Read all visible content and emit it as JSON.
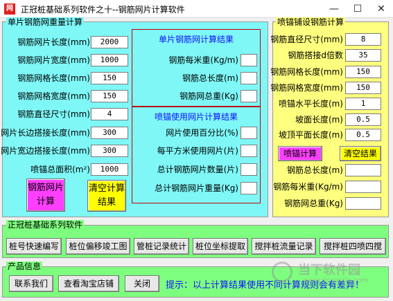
{
  "window": {
    "icon_text": "网",
    "title": "正冠桩基础系列软件之十--钢筋网片计算软件",
    "min": "—",
    "max": "☐",
    "close": "✕"
  },
  "left": {
    "legend": "单片钢筋网重量计算",
    "fields": [
      {
        "label": "钢筋网片长度(mm)",
        "value": "2000"
      },
      {
        "label": "钢筋网片宽度(mm)",
        "value": "1000"
      },
      {
        "label": "钢筋网格长度(mm)",
        "value": "150"
      },
      {
        "label": "钢筋网格宽度(mm)",
        "value": "150"
      },
      {
        "label": "钢筋直径尺寸(mm)",
        "value": "4"
      },
      {
        "label": "网片长边搭接长度(mm)",
        "value": "300"
      },
      {
        "label": "网片宽边搭接长度(mm)",
        "value": "300"
      },
      {
        "label": "喷锚总面积(m²)",
        "value": "1000"
      }
    ],
    "calc_btn": "钢筋网片计算",
    "clear_btn": "清空计算结果"
  },
  "results1": {
    "title": "单片钢筋网计算结果",
    "fields": [
      {
        "label": "钢筋每米重(Kg/m)",
        "value": ""
      },
      {
        "label": "钢筋总长度(m)",
        "value": ""
      },
      {
        "label": "钢筋网总重(Kg)",
        "value": ""
      }
    ]
  },
  "results2": {
    "title": "喷锚使用网片计算结果",
    "fields": [
      {
        "label": "网片使用百分比(%)",
        "value": ""
      },
      {
        "label": "每平方米使用网片(片)",
        "value": ""
      },
      {
        "label": "总计钢筋网片数量(片)",
        "value": ""
      },
      {
        "label": "总计钢筋网片重量(Kg)",
        "value": ""
      }
    ]
  },
  "right": {
    "legend": "喷锚铺设钢筋计算",
    "fields": [
      {
        "label": "钢筋直径尺寸(mm)",
        "value": "8"
      },
      {
        "label": "钢筋搭接d倍数",
        "value": "35"
      },
      {
        "label": "钢筋网格长度(mm)",
        "value": "150"
      },
      {
        "label": "钢筋网格宽度(mm)",
        "value": "150"
      },
      {
        "label": "喷锚水平长度(m)",
        "value": "1"
      },
      {
        "label": "坡面长度(m)",
        "value": "0.5"
      },
      {
        "label": "坡顶平面长度(m)",
        "value": "0.5"
      }
    ],
    "calc_btn": "喷锚计算",
    "clear_btn": "清空结果",
    "results": [
      {
        "label": "钢筋总长度(m)",
        "value": ""
      },
      {
        "label": "钢筋每米重(Kg/m)",
        "value": ""
      },
      {
        "label": "钢筋网总重(Kg)",
        "value": ""
      }
    ]
  },
  "series": {
    "legend": "正冠桩基础系列软件",
    "buttons": [
      "桩号快速编写",
      "桩位偏移竣工图",
      "管桩记录统计",
      "桩位坐标提取",
      "搅拌桩流量记录",
      "搅拌桩四喷四搅"
    ]
  },
  "product": {
    "legend": "产品信息",
    "contact": "联系我们",
    "store": "查看淘宝店铺",
    "close": "关闭",
    "tip": "提示：以上计算结果使用不同计算规则会有差异！"
  },
  "watermark": {
    "text": "当下软件园",
    "url": "www.downxia.com"
  },
  "colors": {
    "cyan": "#7ff7f7",
    "yellow": "#ffff7f",
    "green": "#7fff7f",
    "magenta": "#ff3fff",
    "btn_yellow": "#ffff00",
    "tip_blue": "#1010ff",
    "accent_red": "#c00000"
  }
}
